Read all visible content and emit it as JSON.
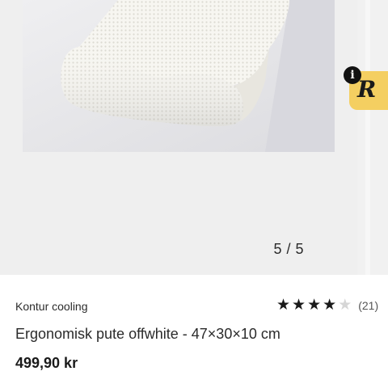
{
  "gallery": {
    "counter": "5 / 5",
    "image_alt": "white memory foam contour pillow",
    "badge_letter": "R",
    "info_letter": "i"
  },
  "product": {
    "brand": "Kontur cooling",
    "title": "Ergonomisk pute offwhite - 47×30×10 cm",
    "price": "499,90 kr",
    "rating": {
      "value": 4,
      "max": 5,
      "count_label": "(21)"
    }
  },
  "icons": {
    "info": "info-icon",
    "badge": "reseller-badge-icon",
    "star": "star-icon"
  }
}
